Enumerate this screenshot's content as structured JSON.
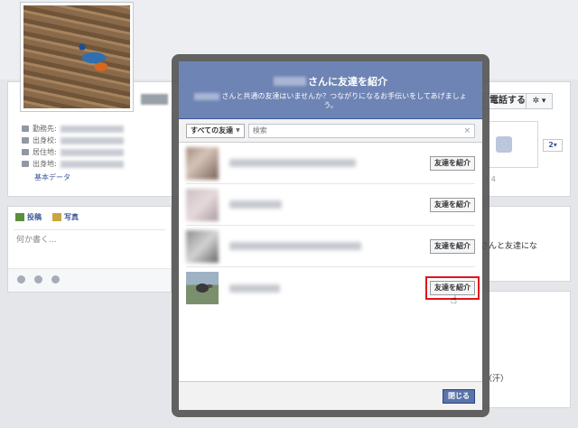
{
  "profile": {
    "info_labels": [
      "勤務先:",
      "出身校:",
      "居住地:",
      "出身地:"
    ],
    "basic_data_link": "基本データ",
    "call_button": "電話する",
    "gear_label": "✲ ▾",
    "like_count_button": "2▾",
    "like_count_text": "! 4"
  },
  "composer": {
    "tab_post": "投稿",
    "tab_photo": "写真",
    "placeholder": "何か書く..."
  },
  "side": {
    "text": "さんと友達にな",
    "sweat_text": "（汗）"
  },
  "dialog": {
    "title_suffix": "さんに友達を紹介",
    "subtitle_line1": "さんと共通の友達はいませんか？つながりになるお手伝いをしてあげましょ",
    "subtitle_line2": "う。",
    "filter_select": "すべての友達",
    "search_placeholder": "検索",
    "search_clear": "×",
    "friends": [
      {
        "button": "友達を紹介",
        "highlighted": false
      },
      {
        "button": "友達を紹介",
        "highlighted": false
      },
      {
        "button": "友達を紹介",
        "highlighted": false
      },
      {
        "button": "友達を紹介",
        "highlighted": true
      }
    ],
    "close_button": "閉じる"
  }
}
